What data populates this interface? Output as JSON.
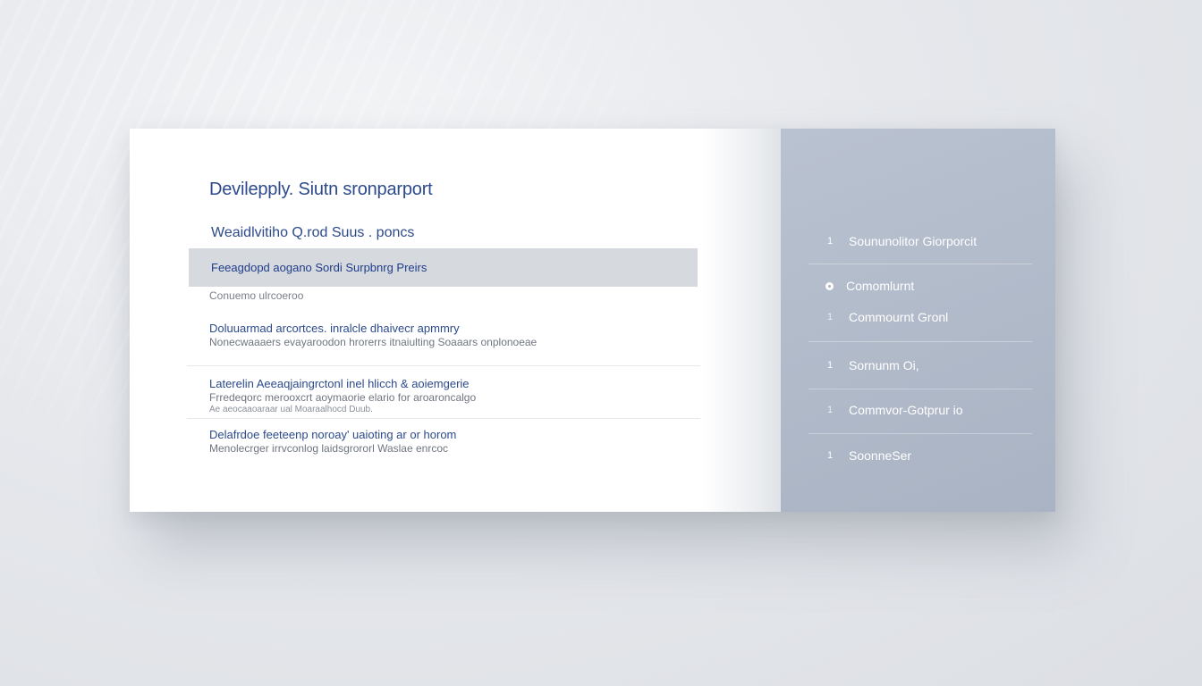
{
  "main": {
    "title": "Devilepply. Siutn sronparport",
    "section_heading": "Weaidlvitiho Q.rod Suus . poncs",
    "highlight_row": "Feeagdopd aogano Sordi Surpbnrg Preirs",
    "meta_label": "Conuemo ulrcoeroo",
    "entries": [
      {
        "title": "Doluuarmad arcortces. inralcle dhaivecr apmmry",
        "desc": "Nonecwaaaers evayaroodon hrorerrs itnaiulting Soaaars onplonoeae",
        "desc_small": ""
      },
      {
        "title": "Laterelin Aeeaqjaingrctonl inel hlicch & aoiemgerie",
        "desc": "Frredeqorc merooxcrt aoymaorie elario for aroaroncalgo",
        "desc_small": "Ae aeocaaoaraar ual Moaraalhocd Duub."
      },
      {
        "title": "Delafrdoe feeteenp noroay' uaioting ar or horom",
        "desc": "Menolecrger irrvconlog laidsgrororl Waslae enrcoc",
        "desc_small": ""
      }
    ]
  },
  "sidebar": {
    "items": [
      {
        "label": "Soununolitor Giorporcit",
        "marker": "1"
      },
      {
        "label": "Comomlurnt",
        "marker": "dot"
      },
      {
        "label": "Commournt Gronl",
        "marker": "1"
      },
      {
        "label": "Sornunm Oi,",
        "marker": "1"
      },
      {
        "label": "Commvor-Gotprur io",
        "marker": "1"
      },
      {
        "label": "SoonneSer",
        "marker": "1"
      }
    ]
  },
  "colors": {
    "accent": "#2c4a8c",
    "sidebar_bg": "#a9b3c3",
    "highlight_bg": "#d6d9de"
  }
}
